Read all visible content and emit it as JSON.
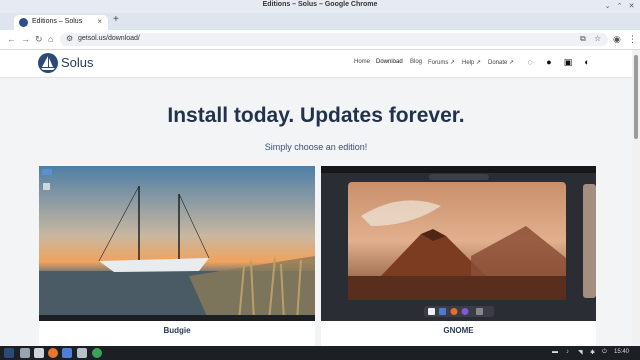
{
  "window": {
    "title": "Editions – Solus – Google Chrome"
  },
  "tab": {
    "title": "Editions – Solus"
  },
  "address": {
    "url": "getsol.us/download/"
  },
  "site": {
    "brand": "Solus",
    "nav": [
      "Home",
      "Download",
      "Blog",
      "Forums ↗",
      "Help ↗",
      "Donate ↗"
    ],
    "active_nav": "Download",
    "header_icons": [
      "matrix-icon",
      "github-icon",
      "mastodon-icon",
      "theme-toggle-icon"
    ]
  },
  "hero": {
    "headline": "Install today. Updates forever.",
    "subtitle": "Simply choose an edition!"
  },
  "editions": [
    {
      "name": "Budgie"
    },
    {
      "name": "GNOME"
    }
  ],
  "taskbar": {
    "clock": "15:40"
  },
  "colors": {
    "accent": "#2c4a78",
    "headline": "#22324d",
    "page_bg": "#f3f4f6"
  }
}
